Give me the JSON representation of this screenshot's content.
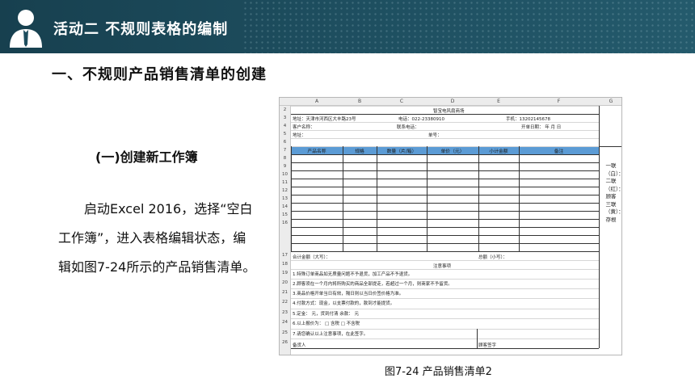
{
  "header": {
    "title": "活动二  不规则表格的编制"
  },
  "section_heading": "一、不规则产品销售清单的创建",
  "sub_heading": "(一)创建新工作簿",
  "paragraph": "启动Excel 2016，选择“空白工作簿”，进入表格编辑状态，编辑如图7-24所示的产品销售清单。",
  "caption": "图7-24  产品销售清单2",
  "sheet": {
    "columns": [
      "A",
      "B",
      "C",
      "D",
      "E",
      "F",
      "G"
    ],
    "rows": [
      "2",
      "3",
      "4",
      "5",
      "6",
      "7",
      "8",
      "9",
      "10",
      "11",
      "12",
      "13",
      "14",
      "15",
      "16",
      "17",
      "18",
      "19",
      "20",
      "21",
      "22",
      "23",
      "24",
      "25",
      "26"
    ],
    "title": "智宝电风扇商场",
    "address_line": "地址：天津市河西区大丰路23号",
    "phone_line": "电话：022-23380910",
    "mobile_line": "手机：13202145678",
    "customer_name": "客户名称：",
    "contact_phone": "联系电话：",
    "open_date": "开单日期：    年    月    日",
    "address2": "地址：",
    "order_no": "单号：",
    "table_headers": [
      "产品名称",
      "规格",
      "数量（片/箱）",
      "单价（元）",
      "小计金额",
      "备注"
    ],
    "total_upper": "合计金额（大写）：",
    "total_small": "总额（小写）：",
    "notes_title": "注意事项",
    "notes": [
      "1.特殊订单商品如无质量问题不予退货，加工产品不予退货。",
      "2.顾客须在一个月内将所购买的商品全部提走，若超过一个月，则商家不予留货。",
      "3.商品价格开单当日有效，隔日则以当日价签价格为准。",
      "4.付款方式：现金，以支票付款的，款到才能提货。",
      "5.定金：          元，货到付清          余款：          元",
      "6.以上报价为：  □ 含税    □ 不含税",
      "7.请您确认以上注意事项，在此签字。"
    ],
    "shipper": "备货人",
    "customer_sign": "顾客签字",
    "vertical_note": "一联（白）：二联（红）：顾客三联（黄）：存根"
  }
}
